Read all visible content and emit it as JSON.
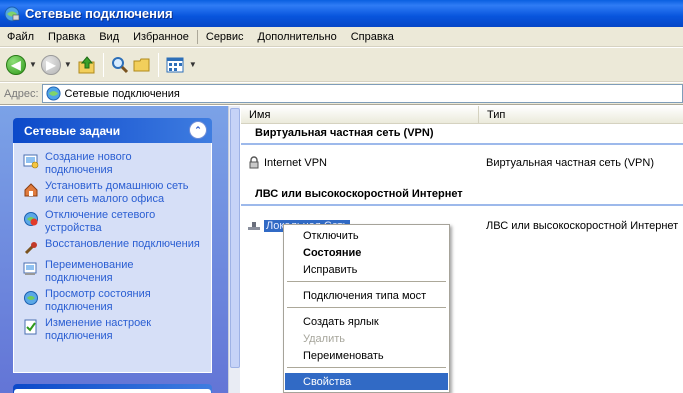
{
  "window": {
    "title": "Сетевые подключения"
  },
  "menu": [
    "Файл",
    "Правка",
    "Вид",
    "Избранное",
    "Сервис",
    "Дополнительно",
    "Справка"
  ],
  "address": {
    "label": "Адрес:",
    "value": "Сетевые подключения"
  },
  "tasks": {
    "title": "Сетевые задачи",
    "items": [
      {
        "label": "Создание нового подключения",
        "icon": "new-connection-icon"
      },
      {
        "label": "Установить домашнюю сеть или сеть малого офиса",
        "icon": "home-network-icon"
      },
      {
        "label": "Отключение сетевого устройства",
        "icon": "disable-device-icon"
      },
      {
        "label": "Восстановление подключения",
        "icon": "repair-icon"
      },
      {
        "label": "Переименование подключения",
        "icon": "rename-icon"
      },
      {
        "label": "Просмотр состояния подключения",
        "icon": "status-icon"
      },
      {
        "label": "Изменение настроек подключения",
        "icon": "settings-icon"
      }
    ]
  },
  "columns": {
    "name": "Имя",
    "type": "Тип"
  },
  "groups": [
    {
      "title": "Виртуальная частная сеть (VPN)",
      "items": [
        {
          "name": "Internet VPN",
          "type": "Виртуальная частная сеть (VPN)"
        }
      ]
    },
    {
      "title": "ЛВС или высокоскоростной Интернет",
      "items": [
        {
          "name": "Локальная Сеть",
          "type": "ЛВС или высокоскоростной Интернет"
        }
      ]
    }
  ],
  "context_menu": {
    "items": [
      {
        "label": "Отключить"
      },
      {
        "label": "Состояние",
        "bold": true
      },
      {
        "label": "Исправить"
      },
      {
        "label": "Подключения типа мост"
      },
      {
        "label": "Создать ярлык"
      },
      {
        "label": "Удалить",
        "disabled": true
      },
      {
        "label": "Переименовать"
      },
      {
        "label": "Свойства",
        "highlighted": true
      }
    ]
  },
  "colors": {
    "selection": "#316ac5",
    "task_link": "#2a5ed2",
    "titlebar": "#0855dd"
  }
}
